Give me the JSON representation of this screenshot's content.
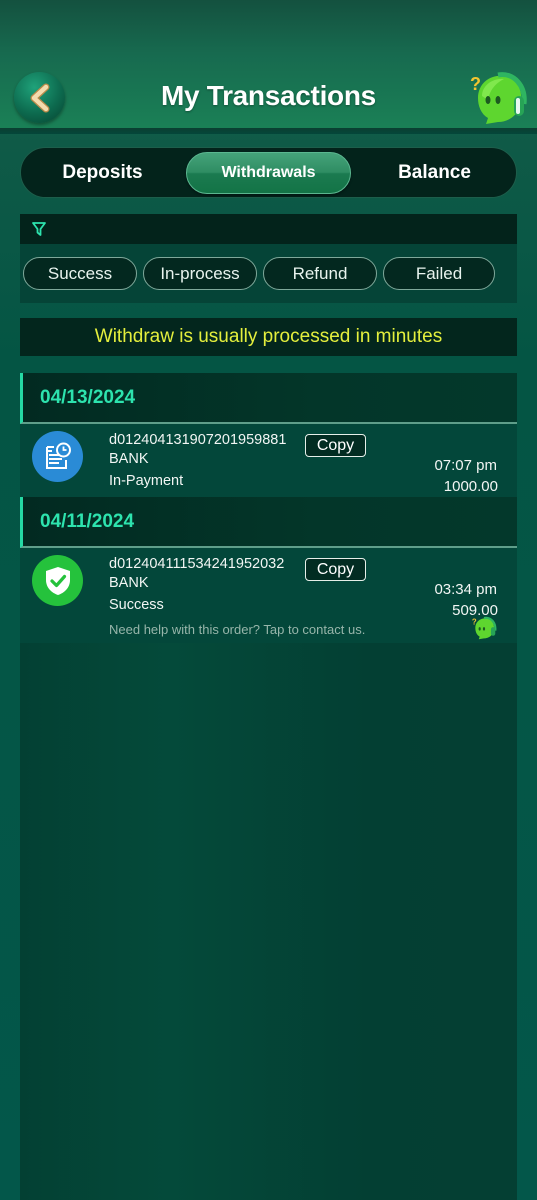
{
  "header": {
    "title": "My Transactions",
    "back_icon": "chevron-left-icon",
    "support_icon": "customer-support-mascot-icon"
  },
  "tabs": [
    {
      "label": "Deposits",
      "active": false
    },
    {
      "label": "Withdrawals",
      "active": true
    },
    {
      "label": "Balance",
      "active": false
    }
  ],
  "filter": {
    "icon": "filter-icon",
    "chips": [
      "Success",
      "In-process",
      "Refund",
      "Failed"
    ]
  },
  "notice": "Withdraw is usually processed in minutes",
  "colors": {
    "accent": "#2de3ae",
    "notice_text": "#e4ef3d",
    "pending_icon_bg": "#2a8bd6",
    "success_icon_bg": "#25c23c"
  },
  "groups": [
    {
      "date": "04/13/2024",
      "transactions": [
        {
          "id": "d012404131907201959881",
          "copy_label": "Copy",
          "channel": "BANK",
          "status": "In-Payment",
          "status_icon": "document-clock-icon",
          "time": "07:07 pm",
          "amount": "1000.00"
        }
      ]
    },
    {
      "date": "04/11/2024",
      "transactions": [
        {
          "id": "d012404111534241952032",
          "copy_label": "Copy",
          "channel": "BANK",
          "status": "Success",
          "status_icon": "shield-check-icon",
          "time": "03:34 pm",
          "amount": "509.00",
          "help_text": "Need help with this order? Tap to contact us."
        }
      ]
    }
  ]
}
